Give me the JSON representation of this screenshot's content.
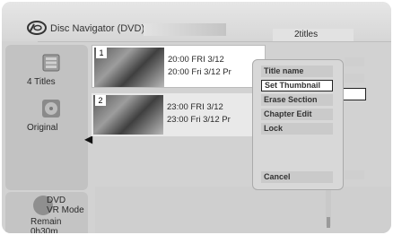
{
  "app": {
    "title": "Disc Navigator (DVD)",
    "title_count": "2titles"
  },
  "left_panel": {
    "titles_label": "4 Titles",
    "original_label": "Original",
    "dvd_mode_line1": "DVD",
    "dvd_mode_line2": "VR Mode",
    "remain_line1": "Remain",
    "remain_line2": "0h30m"
  },
  "titles": [
    {
      "num": "1",
      "line1": "20:00  FRI  3/12",
      "line2": "20:00   Fri 3/12   Pr"
    },
    {
      "num": "2",
      "line1": "23:00  FRI  3/12",
      "line2": "23:00   Fri 3/12   Pr"
    }
  ],
  "menu": {
    "items": [
      "Title name",
      "Set Thumbnail",
      "Erase Section",
      "Chapter Edit",
      "Lock"
    ],
    "cancel": "Cancel",
    "selected_index": 1
  }
}
